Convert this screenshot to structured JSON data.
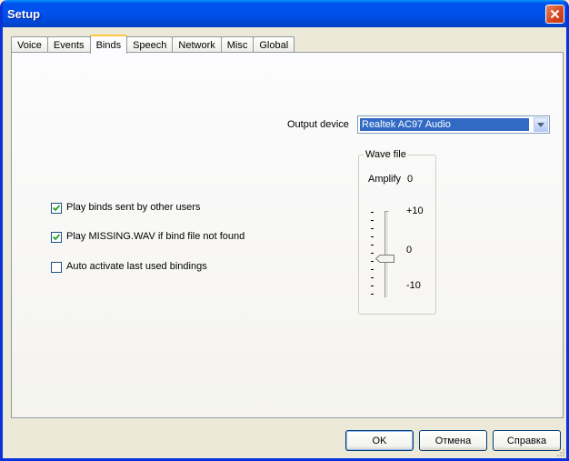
{
  "window": {
    "title": "Setup"
  },
  "tabs": [
    "Voice",
    "Events",
    "Binds",
    "Speech",
    "Network",
    "Misc",
    "Global"
  ],
  "active_tab": "Binds",
  "output": {
    "label": "Output device",
    "value": "Realtek AC97 Audio"
  },
  "wave": {
    "title": "Wave file",
    "amplify_label": "Amplify",
    "amplify_value": "0",
    "scale_top": "+10",
    "scale_mid": "0",
    "scale_bottom": "-10"
  },
  "options": [
    {
      "label": "Play binds sent by other users",
      "checked": true
    },
    {
      "label": "Play MISSING.WAV if bind file not found",
      "checked": true
    },
    {
      "label": "Auto activate last used bindings",
      "checked": false
    }
  ],
  "buttons": {
    "ok": "OK",
    "cancel": "Отмена",
    "help": "Справка"
  },
  "colors": {
    "titlebar": "#0054E3",
    "selection": "#316AC5",
    "dialog": "#ECE9D8"
  },
  "icons": {
    "close": "close-icon",
    "dropdown": "chevron-down-icon"
  }
}
